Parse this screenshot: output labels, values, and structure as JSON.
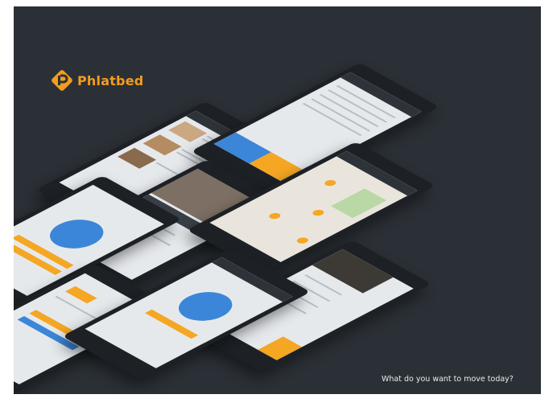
{
  "brand": {
    "name": "Phlatbed",
    "color": "#f39c1f",
    "logo": "phlatbed-p-logo"
  },
  "tagline": "What do you want to move today?",
  "colors": {
    "background": "#2b3036",
    "accent": "#f5a623",
    "blue": "#3b86d8",
    "screen": "#e6e9ec"
  }
}
